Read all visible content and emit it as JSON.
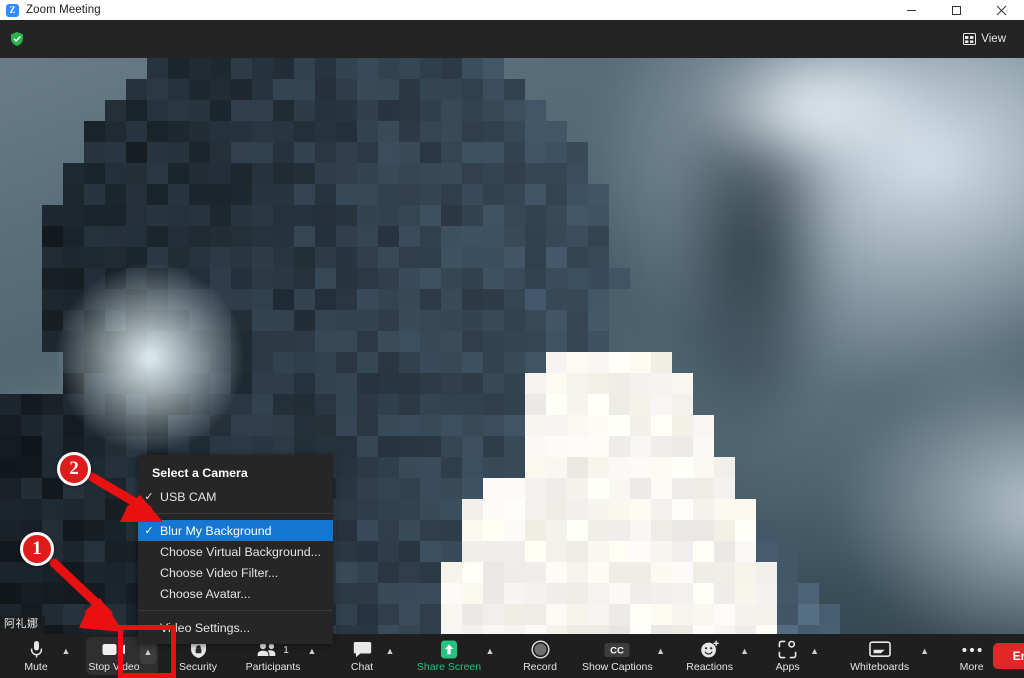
{
  "window": {
    "title": "Zoom Meeting",
    "logo_text": "Z",
    "minimize_label": "Minimize",
    "maximize_label": "Maximize",
    "close_label": "Close"
  },
  "topbar": {
    "encryption_icon": "shield-check-icon",
    "view_label": "View",
    "view_icon": "grid-view-icon"
  },
  "video": {
    "participant_name": "阿礼娜",
    "background_state": "blurred"
  },
  "menu": {
    "header": "Select a Camera",
    "cameras": [
      {
        "label": "USB CAM",
        "checked": true
      }
    ],
    "options": [
      {
        "label": "Blur My Background",
        "checked": true,
        "selected": true
      },
      {
        "label": "Choose Virtual Background...",
        "checked": false,
        "selected": false
      },
      {
        "label": "Choose Video Filter...",
        "checked": false,
        "selected": false
      },
      {
        "label": "Choose Avatar...",
        "checked": false,
        "selected": false
      }
    ],
    "settings": [
      {
        "label": "Video Settings...",
        "checked": false,
        "selected": false
      }
    ],
    "highlight_color": "#1477d1"
  },
  "toolbar": {
    "items": [
      {
        "label": "Mute",
        "icon": "microphone-icon",
        "caret": true
      },
      {
        "label": "Stop Video",
        "icon": "camera-icon",
        "caret": true,
        "active_group": true
      },
      {
        "label": "Security",
        "icon": "shield-icon",
        "caret": false
      },
      {
        "label": "Participants",
        "icon": "participants-icon",
        "caret": true,
        "count": "1"
      },
      {
        "label": "Chat",
        "icon": "chat-bubble-icon",
        "caret": true
      },
      {
        "label": "Share Screen",
        "icon": "share-screen-icon",
        "caret": true,
        "green": true
      },
      {
        "label": "Record",
        "icon": "record-circle-icon",
        "caret": false
      },
      {
        "label": "Show Captions",
        "icon": "closed-caption-icon",
        "caret": true
      },
      {
        "label": "Reactions",
        "icon": "reactions-smiley-icon",
        "caret": true
      },
      {
        "label": "Apps",
        "icon": "apps-icon",
        "caret": true
      },
      {
        "label": "Whiteboards",
        "icon": "whiteboard-icon",
        "caret": true
      },
      {
        "label": "More",
        "icon": "more-dots-icon",
        "caret": false
      }
    ],
    "end_label": "End",
    "end_color": "#e02828",
    "share_color": "#26c281"
  },
  "annotations": {
    "marker_one": "1",
    "marker_two": "2",
    "accent_color": "#e01b1b"
  }
}
